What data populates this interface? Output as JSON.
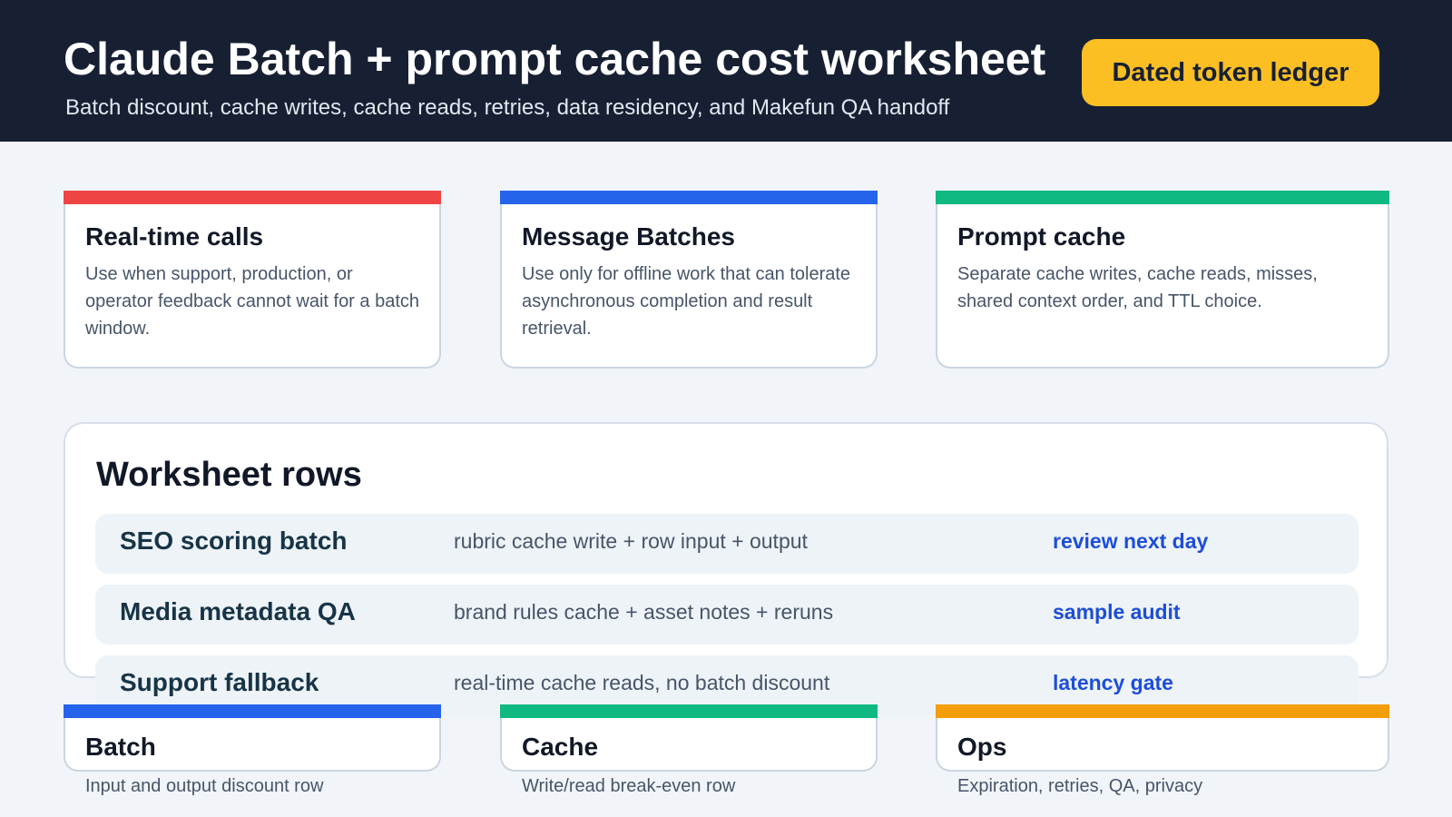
{
  "header": {
    "title": "Claude Batch + prompt cache cost worksheet",
    "subtitle": "Batch discount, cache writes, cache reads, retries, data residency, and Makefun QA handoff",
    "ledger_button": "Dated token ledger"
  },
  "top_cards": [
    {
      "title": "Real-time calls",
      "text": "Use when support, production, or operator feedback cannot wait for a batch window.",
      "accent": "#ef4444"
    },
    {
      "title": "Message Batches",
      "text": "Use only for offline work that can tolerate asynchronous completion and result retrieval.",
      "accent": "#2563eb"
    },
    {
      "title": "Prompt cache",
      "text": "Separate cache writes, cache reads, misses, shared context order, and TTL choice.",
      "accent": "#10b981"
    }
  ],
  "worksheet": {
    "title": "Worksheet rows",
    "rows": [
      {
        "name": "SEO scoring batch",
        "formula": "rubric cache write + row input + output",
        "action": "review next day"
      },
      {
        "name": "Media metadata QA",
        "formula": "brand rules cache + asset notes + reruns",
        "action": "sample audit"
      },
      {
        "name": "Support fallback",
        "formula": "real-time cache reads, no batch discount",
        "action": "latency gate"
      }
    ]
  },
  "bottom_cards": [
    {
      "title": "Batch",
      "note": "Input and output discount row",
      "accent": "#2563eb"
    },
    {
      "title": "Cache",
      "note": "Write/read break-even row",
      "accent": "#10b981"
    },
    {
      "title": "Ops",
      "note": "Expiration, retries, QA, privacy",
      "accent": "#f59e0b"
    }
  ],
  "colors": {
    "header_bg": "#172033",
    "page_bg": "#f1f5f9",
    "button_bg": "#fbbf24",
    "link": "#1d4ed8"
  }
}
